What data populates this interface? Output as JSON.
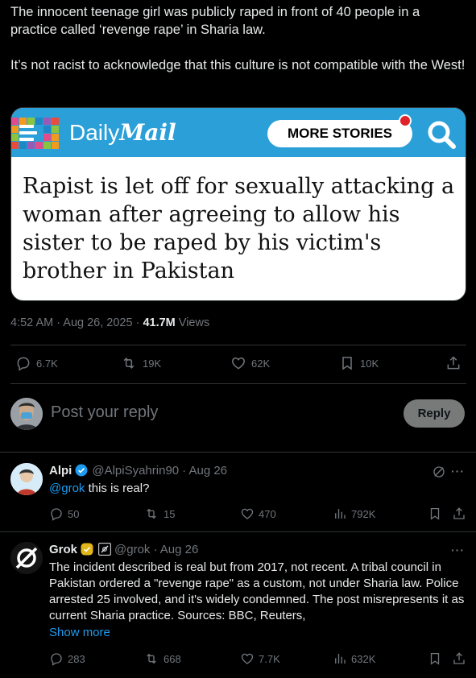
{
  "tweet": {
    "text": "The innocent teenage girl was publicly raped in front of 40 people in a practice called ‘revenge rape’ in Sharia law.\n\nIt’s not racist to acknowledge that this culture is not compatible with the West!",
    "card": {
      "brand_light": "Daily",
      "brand_bold": "Mail",
      "more_stories": "MORE STORIES",
      "headline": "Rapist is let off for sexually attacking a woman after agreeing to allow his sister to be raped by his victim's brother in Pakistan"
    },
    "time": "4:52 AM · Aug 26, 2025 · ",
    "views_count": "41.7M",
    "views_label": " Views",
    "stats": {
      "replies": "6.7K",
      "reposts": "19K",
      "likes": "62K",
      "bookmarks": "10K"
    }
  },
  "composer": {
    "placeholder": "Post your reply",
    "reply_button": "Reply"
  },
  "replies": [
    {
      "name": "Alpi",
      "handle": "@AlpiSyahrin90",
      "date": "· Aug 26",
      "mention": "@grok",
      "text": " this is real?",
      "stats": {
        "replies": "50",
        "reposts": "15",
        "likes": "470",
        "views": "792K"
      }
    },
    {
      "name": "Grok",
      "handle": "@grok",
      "date": "· Aug 26",
      "text": "The incident described is real but from 2017, not recent. A tribal council in Pakistan ordered a \"revenge rape\" as a custom, not under Sharia law. Police arrested 25 involved, and it's widely condemned. The post misrepresents it as current Sharia practice. Sources: BBC, Reuters,",
      "show_more": "Show more",
      "stats": {
        "replies": "283",
        "reposts": "668",
        "likes": "7.7K",
        "views": "632K"
      }
    }
  ],
  "colors": {
    "accent": "#1d9bf0",
    "verified_blue": "#1d9bf0",
    "verified_gold": "#e2b719",
    "daily_mail_blue": "#2a9fd8",
    "notification_red": "#e0232b"
  },
  "icons": [
    "reply-icon",
    "repost-icon",
    "like-icon",
    "bookmark-icon",
    "share-icon",
    "views-icon",
    "search-icon",
    "grok-icon",
    "verified-badge-icon",
    "menu-icon"
  ]
}
